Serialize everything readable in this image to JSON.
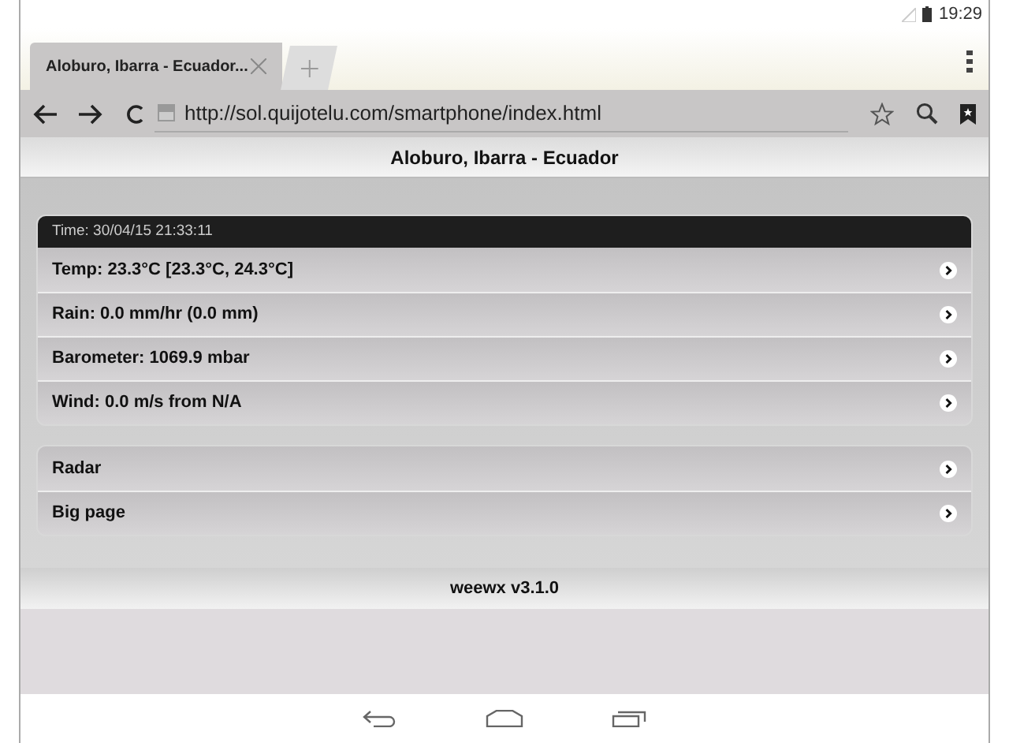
{
  "status_bar": {
    "time": "19:29"
  },
  "tabs": [
    {
      "label": "Aloburo, Ibarra - Ecuador...",
      "selected": true
    }
  ],
  "toolbar": {
    "url": "http://sol.quijotelu.com/smartphone/index.html"
  },
  "page": {
    "header": "Aloburo, Ibarra - Ecuador",
    "time_bar": "Time: 30/04/15 21:33:11",
    "readings": [
      {
        "label": "Temp: 23.3°C [23.3°C, 24.3°C]"
      },
      {
        "label": "Rain: 0.0 mm/hr (0.0 mm)"
      },
      {
        "label": "Barometer: 1069.9 mbar"
      },
      {
        "label": "Wind: 0.0 m/s from N/A"
      }
    ],
    "links": [
      {
        "label": "Radar"
      },
      {
        "label": "Big page"
      }
    ],
    "footer": "weewx v3.1.0"
  }
}
